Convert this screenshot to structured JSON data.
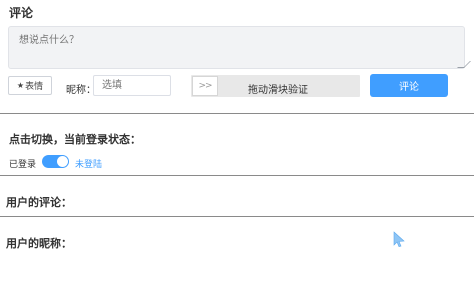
{
  "comment_section": {
    "title": "评论",
    "textarea_placeholder": "想说点什么？",
    "emoji_button_label": "表情",
    "nickname_label": "昵称：",
    "nickname_placeholder": "选填",
    "slider_handle_symbol": ">>",
    "slider_text": "拖动滑块验证",
    "submit_label": "评论"
  },
  "login_section": {
    "title": "点击切换，当前登录状态：",
    "left_label": "已登录",
    "right_label": "未登陆",
    "toggle_on": true
  },
  "user_comment": {
    "label": "用户的评论："
  },
  "user_nickname": {
    "label": "用户的昵称："
  },
  "colors": {
    "accent": "#409eff",
    "track": "#e8e8e8",
    "textarea_bg": "#f2f3f5"
  },
  "icons": {
    "emoji": "star-icon",
    "cursor": "cursor-arrow-icon"
  }
}
